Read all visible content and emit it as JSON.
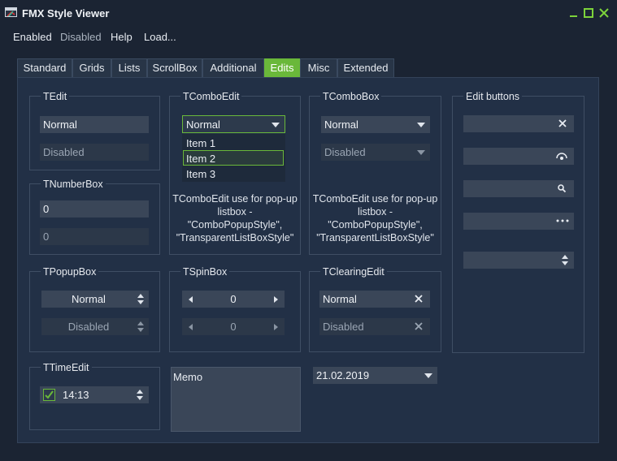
{
  "window": {
    "title": "FMX Style Viewer"
  },
  "menu": {
    "items": [
      "Enabled",
      "Disabled",
      "Help",
      "Load..."
    ]
  },
  "tabs": [
    "Standard",
    "Grids",
    "Lists",
    "ScrollBox",
    "Additional",
    "Edits",
    "Misc",
    "Extended"
  ],
  "active_tab": "Edits",
  "colors": {
    "accent": "#6ab83a",
    "background": "#1b2433",
    "panel": "#223046"
  },
  "tedit": {
    "title": "TEdit",
    "normal": "Normal",
    "disabled": "Disabled"
  },
  "tnumberbox": {
    "title": "TNumberBox",
    "value1": "0",
    "value2": "0"
  },
  "tcomboedit": {
    "title": "TComboEdit",
    "value": "Normal",
    "items": [
      "Item 1",
      "Item 2",
      "Item 3"
    ],
    "selected_item": "Item 2",
    "desc": [
      "TComboEdit use for pop-up",
      "listbox -",
      "\"ComboPopupStyle\",",
      "\"TransparentListBoxStyle\""
    ]
  },
  "tcombobox": {
    "title": "TComboBox",
    "normal": "Normal",
    "disabled": "Disabled",
    "desc": [
      "TComboEdit use for pop-up",
      "listbox -",
      "\"ComboPopupStyle\",",
      "\"TransparentListBoxStyle\""
    ]
  },
  "edit_buttons": {
    "title": "Edit buttons",
    "icons": [
      "clear-icon",
      "eye-icon",
      "search-icon",
      "ellipsis-icon",
      "spin-icon"
    ]
  },
  "tpopupbox": {
    "title": "TPopupBox",
    "normal": "Normal",
    "disabled": "Disabled"
  },
  "tspinbox": {
    "title": "TSpinBox",
    "value1": "0",
    "value2": "0"
  },
  "tclearingedit": {
    "title": "TClearingEdit",
    "normal": "Normal",
    "disabled": "Disabled"
  },
  "ttimeedit": {
    "title": "TTimeEdit",
    "value": "14:13",
    "checked": true
  },
  "memo": {
    "text": "Memo"
  },
  "dateedit": {
    "value": "21.02.2019"
  }
}
